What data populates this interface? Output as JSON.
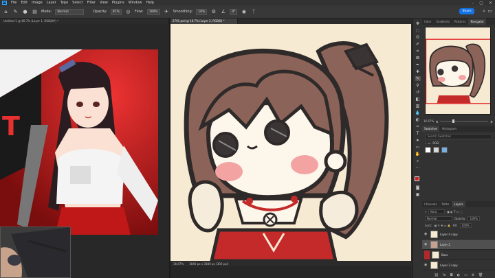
{
  "menubar": {
    "app_icon": "Ps",
    "items": [
      "File",
      "Edit",
      "Image",
      "Layer",
      "Type",
      "Select",
      "Filter",
      "View",
      "Plugins",
      "Window",
      "Help"
    ],
    "window_controls": [
      "–",
      "▢",
      "✕"
    ]
  },
  "options": {
    "mode_label": "Mode:",
    "mode_value": "Normal",
    "opacity_label": "Opacity:",
    "opacity_value": "87%",
    "flow_label": "Flow:",
    "flow_value": "100%",
    "smoothing_label": "Smoothing:",
    "smoothing_value": "10%",
    "angle_value": "0°",
    "share_label": "Share"
  },
  "tabs": {
    "left_doc": "Untitled-1 @ 66.7% (Layer 1, RGB/8#) *",
    "main_doc": "2791.psd @ 16.7% (Layer 2, RGB/8) *"
  },
  "status": {
    "zoom": "16.67%",
    "doc_size": "3840 px x 3840 px (300 ppi)"
  },
  "navigator": {
    "tabs": [
      "Color",
      "Gradients",
      "Patterns",
      "Navigator"
    ],
    "active_tab": "Navigator",
    "zoom": "16.67%",
    "zoom_level": 0.25
  },
  "swatches": {
    "tabs": [
      "Swatches",
      "Histogram"
    ],
    "search_placeholder": "Search Swatches",
    "group_label": "RGB",
    "colors": [
      "#ffffff",
      "#d8d8d8",
      "#7bb0dc"
    ]
  },
  "layers": {
    "tabs": [
      "Channels",
      "Paths",
      "Layers"
    ],
    "kind_label": "Kind",
    "blend_mode": "Normal",
    "opacity_label": "Opacity:",
    "opacity_value": "100%",
    "lock_label": "Lock:",
    "fill_label": "Fill:",
    "fill_value": "100%",
    "items": [
      {
        "name": "Layer 4 copy"
      },
      {
        "name": "Layer 2"
      },
      {
        "name": "Base"
      },
      {
        "name": "Layer 3 copy"
      }
    ]
  },
  "colors": {
    "canvas_bg": "#f7ead2",
    "accent": "#1473e6",
    "foreground": "#d02020",
    "background": "#ffffff"
  }
}
